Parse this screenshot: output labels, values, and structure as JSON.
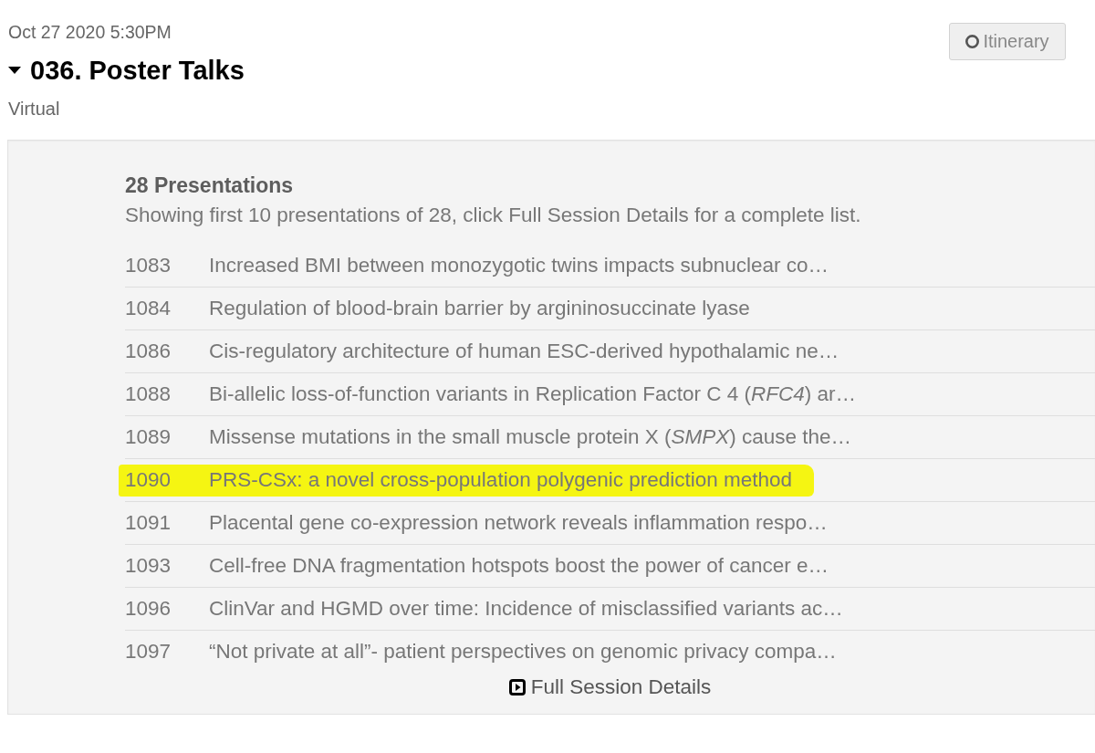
{
  "session": {
    "datetime": "Oct 27 2020 5:30PM",
    "title": "036. Poster Talks",
    "expanded": true,
    "location": "Virtual"
  },
  "itinerary_button": {
    "label": "Itinerary"
  },
  "presentations": {
    "heading": "28 Presentations",
    "note": "Showing first 10 presentations of 28, click Full Session Details for a complete list.",
    "rows": [
      {
        "number": "1083",
        "title": "Increased BMI between monozygotic twins impacts subnuclear co…",
        "highlighted": false
      },
      {
        "number": "1084",
        "title": "Regulation of blood-brain barrier by argininosuccinate lyase",
        "highlighted": false
      },
      {
        "number": "1086",
        "title": "Cis-regulatory architecture of human ESC-derived hypothalamic ne…",
        "highlighted": false
      },
      {
        "number": "1088",
        "title": "Bi-allelic loss-of-function variants in Replication Factor C 4 (*RFC4*) ar…",
        "highlighted": false
      },
      {
        "number": "1089",
        "title": "Missense mutations in the small muscle protein X (*SMPX*) cause the…",
        "highlighted": false
      },
      {
        "number": "1090",
        "title": "PRS-CSx: a novel cross-population polygenic prediction method",
        "highlighted": true
      },
      {
        "number": "1091",
        "title": "Placental gene co-expression network reveals inflammation respo…",
        "highlighted": false
      },
      {
        "number": "1093",
        "title": "Cell-free DNA fragmentation hotspots boost the power of cancer e…",
        "highlighted": false
      },
      {
        "number": "1096",
        "title": "ClinVar and HGMD over time: Incidence of misclassified variants ac…",
        "highlighted": false
      },
      {
        "number": "1097",
        "title": "“Not private at all”- patient perspectives on genomic privacy compa…",
        "highlighted": false
      }
    ],
    "full_details_link": "Full Session Details"
  }
}
